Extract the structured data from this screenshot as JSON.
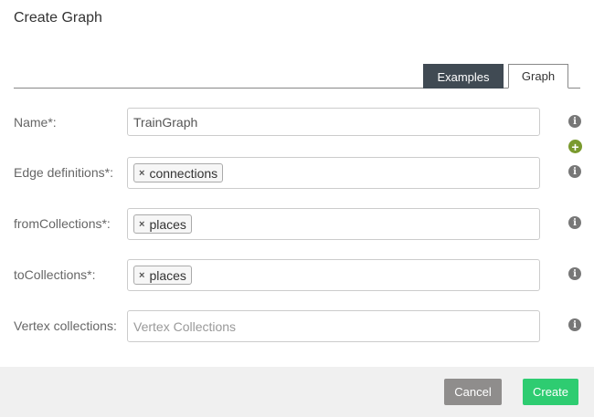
{
  "dialog": {
    "title": "Create Graph"
  },
  "tabs": [
    {
      "label": "Examples",
      "active": false
    },
    {
      "label": "Graph",
      "active": true
    }
  ],
  "fields": {
    "name": {
      "label": "Name*:",
      "value": "TrainGraph"
    },
    "edge_definitions": {
      "label": "Edge definitions*:",
      "tags": [
        "connections"
      ]
    },
    "from_collections": {
      "label": "fromCollections*:",
      "tags": [
        "places"
      ]
    },
    "to_collections": {
      "label": "toCollections*:",
      "tags": [
        "places"
      ]
    },
    "vertex_collections": {
      "label": "Vertex collections:",
      "placeholder": "Vertex Collections"
    }
  },
  "icons": {
    "info": "info-icon",
    "add": "plus-circle-icon",
    "tag_remove": "close-icon",
    "info_glyph": "i",
    "add_glyph": "+",
    "remove_glyph": "×"
  },
  "footer": {
    "cancel_label": "Cancel",
    "create_label": "Create"
  },
  "colors": {
    "active_tab_bg": "#404a53",
    "create_button": "#2ecc71",
    "cancel_button": "#8f8d8c",
    "add_icon": "#7a9a2e"
  }
}
